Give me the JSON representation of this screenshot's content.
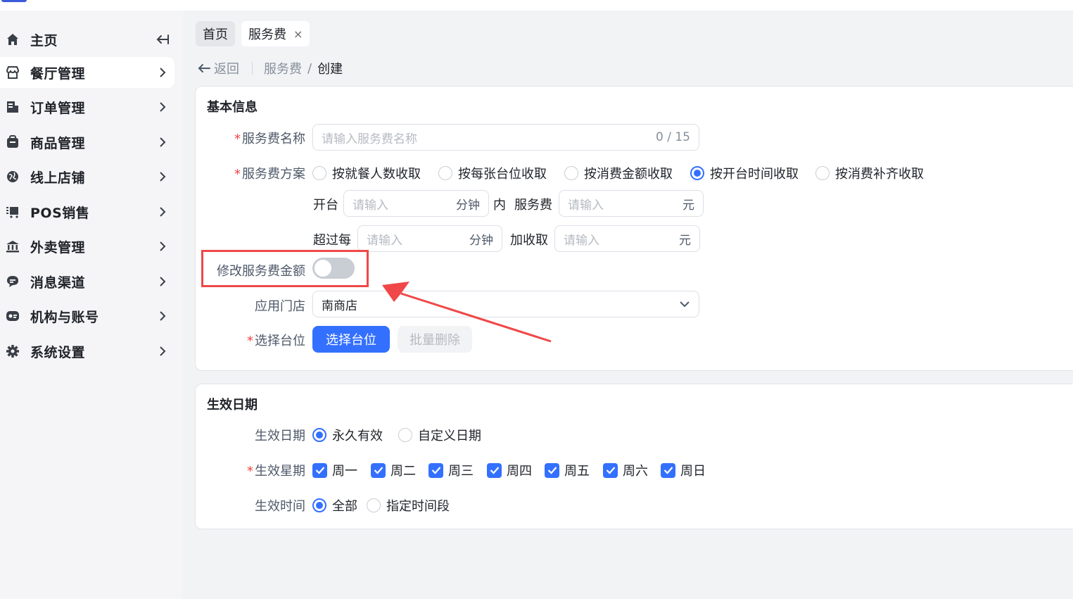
{
  "sidebar": {
    "home_label": "主页",
    "items": [
      {
        "label": "餐厅管理",
        "icon": "store-icon",
        "active": true
      },
      {
        "label": "订单管理",
        "icon": "order-icon",
        "active": false
      },
      {
        "label": "商品管理",
        "icon": "goods-icon",
        "active": false
      },
      {
        "label": "线上店铺",
        "icon": "globe-icon",
        "active": false
      },
      {
        "label": "POS销售",
        "icon": "pos-icon",
        "active": false
      },
      {
        "label": "外卖管理",
        "icon": "bank-icon",
        "active": false
      },
      {
        "label": "消息渠道",
        "icon": "message-icon",
        "active": false
      },
      {
        "label": "机构与账号",
        "icon": "account-icon",
        "active": false
      },
      {
        "label": "系统设置",
        "icon": "gear-icon",
        "active": false
      }
    ]
  },
  "tabs": [
    {
      "label": "首页",
      "active": false
    },
    {
      "label": "服务费",
      "active": true,
      "closable": true
    }
  ],
  "tab_close_glyph": "×",
  "breadcrumb": {
    "back_label": "返回",
    "parent": "服务费",
    "separator": "/",
    "current": "创建"
  },
  "basic_info": {
    "title": "基本信息",
    "name_field": {
      "label": "服务费名称",
      "placeholder": "请输入服务费名称",
      "counter": "0 / 15",
      "required": true
    },
    "plan": {
      "label": "服务费方案",
      "required": true,
      "options": [
        {
          "label": "按就餐人数收取",
          "selected": false
        },
        {
          "label": "按每张台位收取",
          "selected": false
        },
        {
          "label": "按消费金额收取",
          "selected": false
        },
        {
          "label": "按开台时间收取",
          "selected": true
        },
        {
          "label": "按消费补齐收取",
          "selected": false
        }
      ]
    },
    "open_rule": {
      "prefix": "开台",
      "minutes_placeholder": "请输入",
      "minutes_suffix": "分钟",
      "within": "内",
      "fee_label": "服务费",
      "fee_placeholder": "请输入",
      "fee_suffix": "元"
    },
    "extra_rule": {
      "prefix": "超过每",
      "minutes_placeholder": "请输入",
      "minutes_suffix": "分钟",
      "add_label": "加收取",
      "fee_placeholder": "请输入",
      "fee_suffix": "元"
    },
    "modify_amount": {
      "label": "修改服务费金额",
      "enabled": false
    },
    "store": {
      "label": "应用门店",
      "value": "南商店"
    },
    "tables": {
      "label": "选择台位",
      "required": true,
      "select_button": "选择台位",
      "batch_delete_button": "批量删除"
    }
  },
  "effective": {
    "title": "生效日期",
    "date": {
      "label": "生效日期",
      "options": [
        {
          "label": "永久有效",
          "selected": true
        },
        {
          "label": "自定义日期",
          "selected": false
        }
      ]
    },
    "weekdays": {
      "label": "生效星期",
      "required": true,
      "days": [
        "周一",
        "周二",
        "周三",
        "周四",
        "周五",
        "周六",
        "周日"
      ]
    },
    "time": {
      "label": "生效时间",
      "options": [
        {
          "label": "全部",
          "selected": true
        },
        {
          "label": "指定时间段",
          "selected": false
        }
      ]
    }
  },
  "colors": {
    "primary": "#3370ff",
    "required": "#f53f3f",
    "annotation": "#f04848"
  }
}
